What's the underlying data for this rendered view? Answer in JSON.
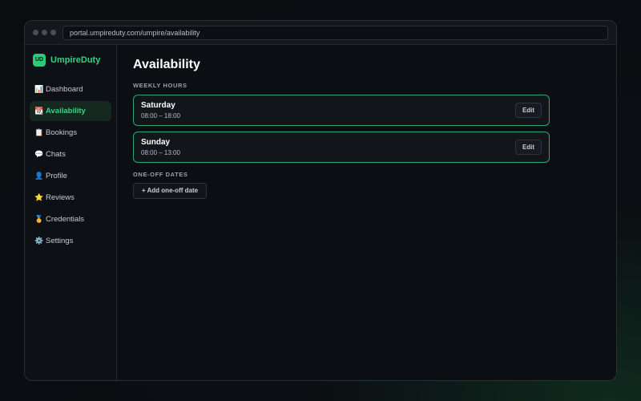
{
  "browser": {
    "url": "portal.umpireduty.com/umpire/availability"
  },
  "brand": {
    "badge": "UD",
    "name": "UmpireDuty"
  },
  "sidebar": {
    "items": [
      {
        "icon": "📊",
        "icon_name": "chart-icon",
        "label": "Dashboard"
      },
      {
        "icon": "📆",
        "icon_name": "calendar-icon",
        "label": "Availability",
        "active": true
      },
      {
        "icon": "📋",
        "icon_name": "clipboard-icon",
        "label": "Bookings"
      },
      {
        "icon": "💬",
        "icon_name": "speech-bubble-icon",
        "label": "Chats"
      },
      {
        "icon": "👤",
        "icon_name": "user-icon",
        "label": "Profile"
      },
      {
        "icon": "⭐",
        "icon_name": "star-icon",
        "label": "Reviews"
      },
      {
        "icon": "🥇",
        "icon_name": "medal-icon",
        "label": "Credentials"
      },
      {
        "icon": "⚙️",
        "icon_name": "gear-icon",
        "label": "Settings"
      }
    ]
  },
  "main": {
    "title": "Availability",
    "weekly_label": "WEEKLY HOURS",
    "weekly": [
      {
        "day": "Saturday",
        "hours": "08:00 – 18:00",
        "edit": "Edit"
      },
      {
        "day": "Sunday",
        "hours": "08:00 – 13:00",
        "edit": "Edit"
      }
    ],
    "oneoff_label": "ONE-OFF DATES",
    "add_oneoff": "+ Add one-off date"
  },
  "colors": {
    "accent": "#39d486",
    "card_border": "#2ea86b",
    "active_bg": "#14281f"
  }
}
